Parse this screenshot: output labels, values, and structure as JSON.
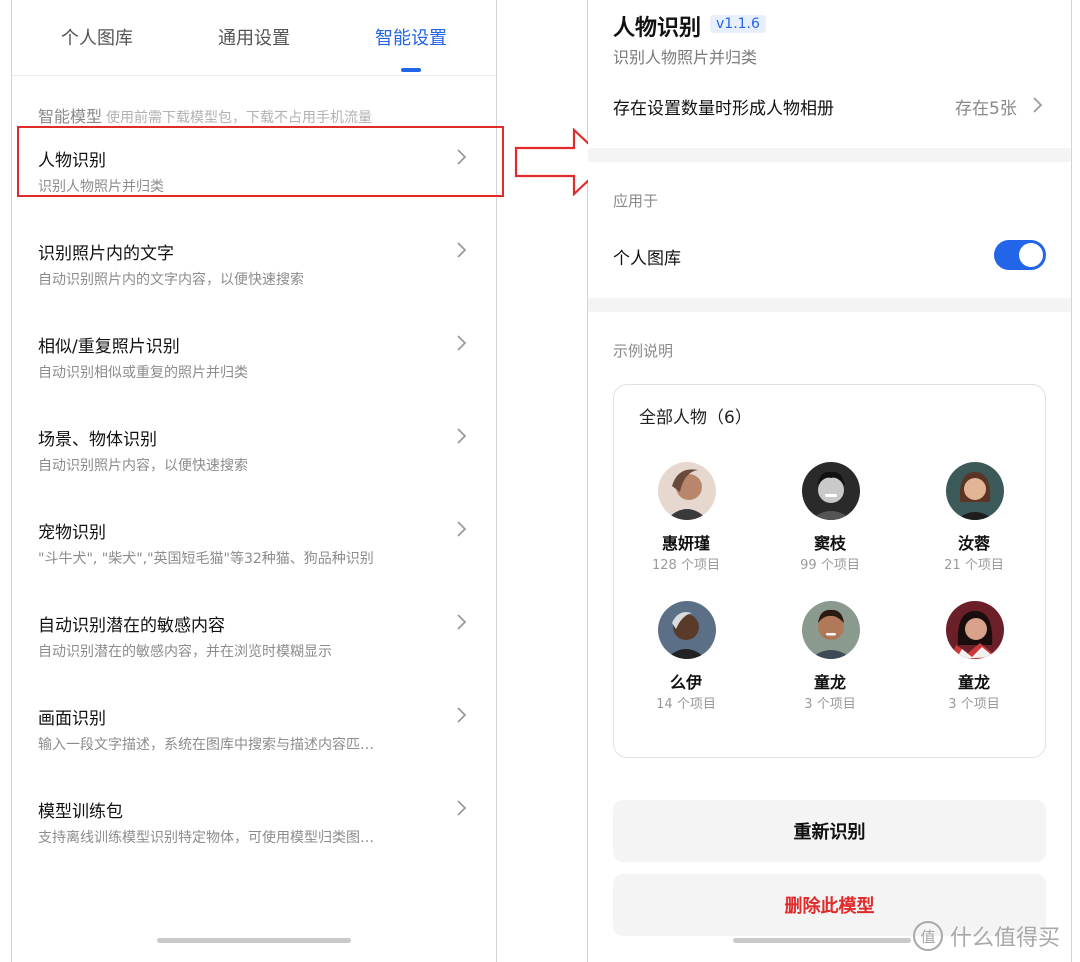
{
  "left": {
    "tabs": [
      {
        "label": "个人图库",
        "active": false
      },
      {
        "label": "通用设置",
        "active": false
      },
      {
        "label": "智能设置",
        "active": true
      }
    ],
    "section_title": "智能模型",
    "section_hint": "使用前需下载模型包，下载不占用手机流量",
    "items": [
      {
        "title": "人物识别",
        "desc": "识别人物照片并归类",
        "icon": "chevron-right-icon"
      },
      {
        "title": "识别照片内的文字",
        "desc": "自动识别照片内的文字内容，以便快速搜索",
        "icon": "chevron-right-icon"
      },
      {
        "title": "相似/重复照片识别",
        "desc": "自动识别相似或重复的照片并归类",
        "icon": "chevron-right-icon"
      },
      {
        "title": "场景、物体识别",
        "desc": "自动识别照片内容，以便快速搜索",
        "icon": "chevron-right-icon"
      },
      {
        "title": "宠物识别",
        "desc": "\"斗牛犬\", \"柴犬\",\"英国短毛猫\"等32种猫、狗品种识别",
        "icon": "chevron-right-icon"
      },
      {
        "title": "自动识别潜在的敏感内容",
        "desc": "自动识别潜在的敏感内容，并在浏览时模糊显示",
        "icon": "chevron-right-icon"
      },
      {
        "title": "画面识别",
        "desc": "输入一段文字描述，系统在图库中搜索与描述内容匹…",
        "icon": "chevron-right-icon"
      },
      {
        "title": "模型训练包",
        "desc": "支持离线训练模型识别特定物体，可使用模型归类图…",
        "icon": "chevron-right-icon"
      }
    ]
  },
  "highlight_color": "#e12a2a",
  "accent_color": "#2265e8",
  "right": {
    "title": "人物识别",
    "version": "v1.1.6",
    "subtitle": "识别人物照片并归类",
    "album_row": {
      "label": "存在设置数量时形成人物相册",
      "value": "存在5张"
    },
    "apply_label": "应用于",
    "toggle_row": {
      "label": "个人图库",
      "on": true
    },
    "example_label": "示例说明",
    "card_title": "全部人物（6）",
    "people": [
      {
        "name": "惠妍瑾",
        "count": "128 个项目"
      },
      {
        "name": "窦枝",
        "count": "99 个项目"
      },
      {
        "name": "汝蓉",
        "count": "21 个项目"
      },
      {
        "name": "么伊",
        "count": "14 个项目"
      },
      {
        "name": "童龙",
        "count": "3 个项目"
      },
      {
        "name": "童龙",
        "count": "3 个项目"
      }
    ],
    "rescan_button": "重新识别",
    "delete_button": "删除此模型"
  },
  "watermark": "什么值得买",
  "watermark_logo_glyph": "值"
}
